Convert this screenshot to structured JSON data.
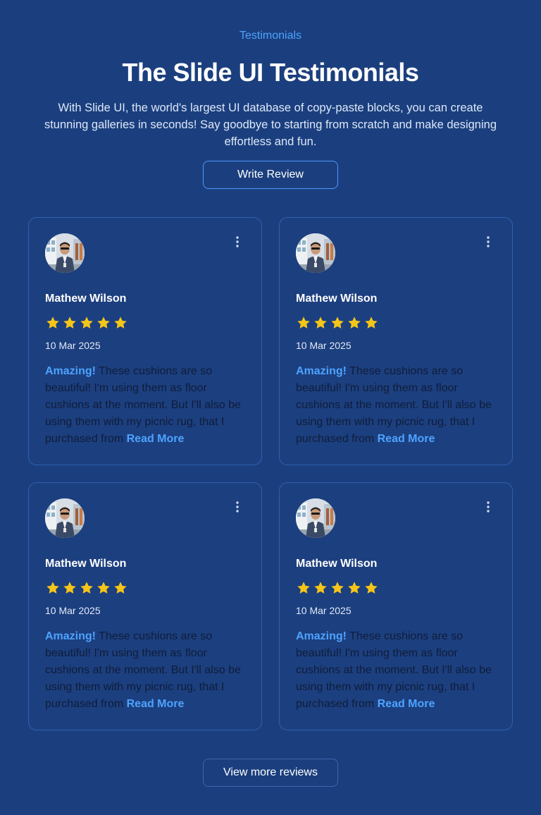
{
  "header": {
    "eyebrow": "Testimonials",
    "title": "The Slide UI Testimonials",
    "subtitle": "With Slide UI, the world's largest UI database of copy-paste blocks, you can create stunning galleries in seconds! Say goodbye to starting from scratch and make designing effortless and fun.",
    "write_review_label": "Write Review"
  },
  "reviews": [
    {
      "name": "Mathew Wilson",
      "rating": 5,
      "date": "10 Mar 2025",
      "highlight": "Amazing!",
      "text": " These cushions are so beautiful! I'm using them as floor cushions at the moment. But I'll also be using them with my picnic rug, that I purchased from ",
      "read_more": "Read More",
      "avatar_icon": "person-photo",
      "menu_icon": "more-vertical-icon"
    },
    {
      "name": "Mathew Wilson",
      "rating": 5,
      "date": "10 Mar 2025",
      "highlight": "Amazing!",
      "text": " These cushions are so beautiful! I'm using them as floor cushions at the moment. But I'll also be using them with my picnic rug, that I purchased from ",
      "read_more": "Read More",
      "avatar_icon": "person-photo",
      "menu_icon": "more-vertical-icon"
    },
    {
      "name": "Mathew Wilson",
      "rating": 5,
      "date": "10 Mar 2025",
      "highlight": "Amazing!",
      "text": " These cushions are so beautiful! I'm using them as floor cushions at the moment. But I'll also be using them with my picnic rug, that I purchased from ",
      "read_more": "Read More",
      "avatar_icon": "person-photo",
      "menu_icon": "more-vertical-icon"
    },
    {
      "name": "Mathew Wilson",
      "rating": 5,
      "date": "10 Mar 2025",
      "highlight": "Amazing!",
      "text": " These cushions are so beautiful! I'm using them as floor cushions at the moment. But I'll also be using them with my picnic rug, that I purchased from ",
      "read_more": "Read More",
      "avatar_icon": "person-photo",
      "menu_icon": "more-vertical-icon"
    }
  ],
  "footer": {
    "view_more_label": "View more reviews"
  },
  "colors": {
    "background": "#1b3f7e",
    "accent": "#4da3ff",
    "star": "#f5c518",
    "card_border": "#2f5fb1"
  }
}
